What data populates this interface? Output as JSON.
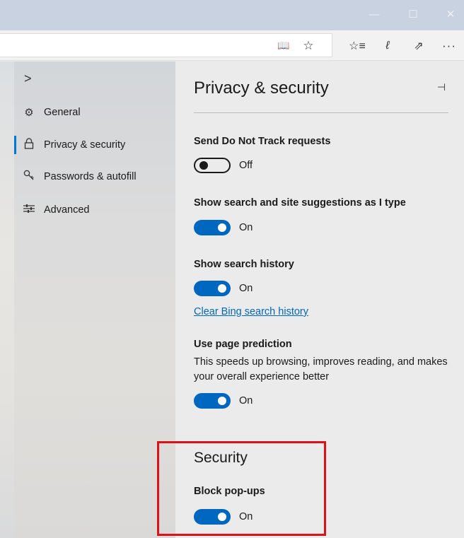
{
  "window": {
    "minimize_icon": "minimize-icon",
    "maximize_icon": "maximize-icon",
    "close_icon": "close-icon",
    "minimize_glyph": "—",
    "maximize_glyph": "☐",
    "close_glyph": "✕"
  },
  "toolbar": {
    "address_value": "",
    "reading_view_glyph": "📖",
    "favorite_glyph": "☆",
    "favorites_list_glyph": "☆≡",
    "notes_glyph": "ℓ",
    "share_glyph": "⇗",
    "more_glyph": "···"
  },
  "nav": {
    "collapse_glyph": ">",
    "items": [
      {
        "label": "General",
        "icon": "gear-icon",
        "glyph": "⚙"
      },
      {
        "label": "Privacy & security",
        "icon": "lock-icon",
        "glyph": "🔒"
      },
      {
        "label": "Passwords & autofill",
        "icon": "key-icon",
        "glyph": "🔑"
      },
      {
        "label": "Advanced",
        "icon": "sliders-icon",
        "glyph": "☰"
      }
    ]
  },
  "panel": {
    "title": "Privacy & security",
    "pin_glyph": "⊣",
    "settings": {
      "dnt": {
        "label": "Send Do Not Track requests",
        "state": "Off"
      },
      "suggestions": {
        "label": "Show search and site suggestions as I type",
        "state": "On"
      },
      "history": {
        "label": "Show search history",
        "state": "On"
      },
      "clear_link": "Clear Bing search history",
      "prediction": {
        "label": "Use page prediction",
        "description": "This speeds up browsing, improves reading, and makes your overall experience better",
        "state": "On"
      }
    },
    "security": {
      "heading": "Security",
      "popups": {
        "label": "Block pop-ups",
        "state": "On"
      }
    }
  },
  "colors": {
    "accent": "#0067c0",
    "highlight": "#e0101a"
  }
}
